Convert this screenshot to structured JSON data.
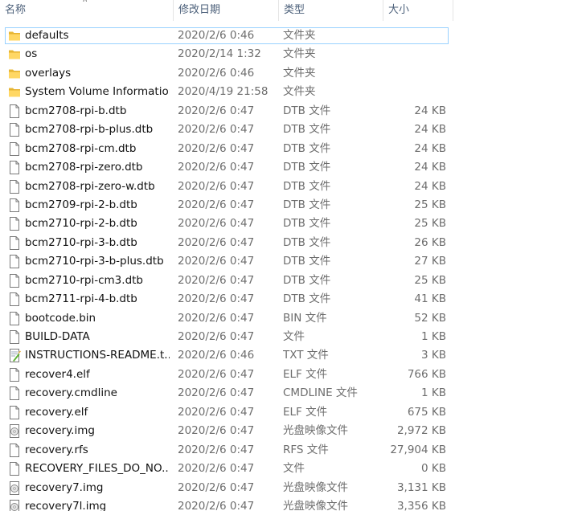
{
  "columns": {
    "name": "名称",
    "date": "修改日期",
    "type": "类型",
    "size": "大小"
  },
  "files": [
    {
      "name": "defaults",
      "date": "2020/2/6 0:46",
      "type": "文件夹",
      "size": "",
      "icon": "folder-icon"
    },
    {
      "name": "os",
      "date": "2020/2/14 1:32",
      "type": "文件夹",
      "size": "",
      "icon": "folder-icon"
    },
    {
      "name": "overlays",
      "date": "2020/2/6 0:46",
      "type": "文件夹",
      "size": "",
      "icon": "folder-icon"
    },
    {
      "name": "System Volume Information",
      "date": "2020/4/19 21:58",
      "type": "文件夹",
      "size": "",
      "icon": "folder-icon"
    },
    {
      "name": "bcm2708-rpi-b.dtb",
      "date": "2020/2/6 0:47",
      "type": "DTB 文件",
      "size": "24 KB",
      "icon": "file-icon"
    },
    {
      "name": "bcm2708-rpi-b-plus.dtb",
      "date": "2020/2/6 0:47",
      "type": "DTB 文件",
      "size": "24 KB",
      "icon": "file-icon"
    },
    {
      "name": "bcm2708-rpi-cm.dtb",
      "date": "2020/2/6 0:47",
      "type": "DTB 文件",
      "size": "24 KB",
      "icon": "file-icon"
    },
    {
      "name": "bcm2708-rpi-zero.dtb",
      "date": "2020/2/6 0:47",
      "type": "DTB 文件",
      "size": "24 KB",
      "icon": "file-icon"
    },
    {
      "name": "bcm2708-rpi-zero-w.dtb",
      "date": "2020/2/6 0:47",
      "type": "DTB 文件",
      "size": "24 KB",
      "icon": "file-icon"
    },
    {
      "name": "bcm2709-rpi-2-b.dtb",
      "date": "2020/2/6 0:47",
      "type": "DTB 文件",
      "size": "25 KB",
      "icon": "file-icon"
    },
    {
      "name": "bcm2710-rpi-2-b.dtb",
      "date": "2020/2/6 0:47",
      "type": "DTB 文件",
      "size": "25 KB",
      "icon": "file-icon"
    },
    {
      "name": "bcm2710-rpi-3-b.dtb",
      "date": "2020/2/6 0:47",
      "type": "DTB 文件",
      "size": "26 KB",
      "icon": "file-icon"
    },
    {
      "name": "bcm2710-rpi-3-b-plus.dtb",
      "date": "2020/2/6 0:47",
      "type": "DTB 文件",
      "size": "27 KB",
      "icon": "file-icon"
    },
    {
      "name": "bcm2710-rpi-cm3.dtb",
      "date": "2020/2/6 0:47",
      "type": "DTB 文件",
      "size": "25 KB",
      "icon": "file-icon"
    },
    {
      "name": "bcm2711-rpi-4-b.dtb",
      "date": "2020/2/6 0:47",
      "type": "DTB 文件",
      "size": "41 KB",
      "icon": "file-icon"
    },
    {
      "name": "bootcode.bin",
      "date": "2020/2/6 0:47",
      "type": "BIN 文件",
      "size": "52 KB",
      "icon": "file-icon"
    },
    {
      "name": "BUILD-DATA",
      "date": "2020/2/6 0:47",
      "type": "文件",
      "size": "1 KB",
      "icon": "file-icon"
    },
    {
      "name": "INSTRUCTIONS-README.t...",
      "date": "2020/2/6 0:46",
      "type": "TXT 文件",
      "size": "3 KB",
      "icon": "text-document-icon"
    },
    {
      "name": "recover4.elf",
      "date": "2020/2/6 0:47",
      "type": "ELF 文件",
      "size": "766 KB",
      "icon": "file-icon"
    },
    {
      "name": "recovery.cmdline",
      "date": "2020/2/6 0:47",
      "type": "CMDLINE 文件",
      "size": "1 KB",
      "icon": "file-icon"
    },
    {
      "name": "recovery.elf",
      "date": "2020/2/6 0:47",
      "type": "ELF 文件",
      "size": "675 KB",
      "icon": "file-icon"
    },
    {
      "name": "recovery.img",
      "date": "2020/2/6 0:47",
      "type": "光盘映像文件",
      "size": "2,972 KB",
      "icon": "disc-image-icon"
    },
    {
      "name": "recovery.rfs",
      "date": "2020/2/6 0:47",
      "type": "RFS 文件",
      "size": "27,904 KB",
      "icon": "file-icon"
    },
    {
      "name": "RECOVERY_FILES_DO_NO...",
      "date": "2020/2/6 0:47",
      "type": "文件",
      "size": "0 KB",
      "icon": "file-icon"
    },
    {
      "name": "recovery7.img",
      "date": "2020/2/6 0:47",
      "type": "光盘映像文件",
      "size": "3,131 KB",
      "icon": "disc-image-icon"
    },
    {
      "name": "recovery7l.img",
      "date": "2020/2/6 0:47",
      "type": "光盘映像文件",
      "size": "3,356 KB",
      "icon": "disc-image-icon"
    }
  ]
}
